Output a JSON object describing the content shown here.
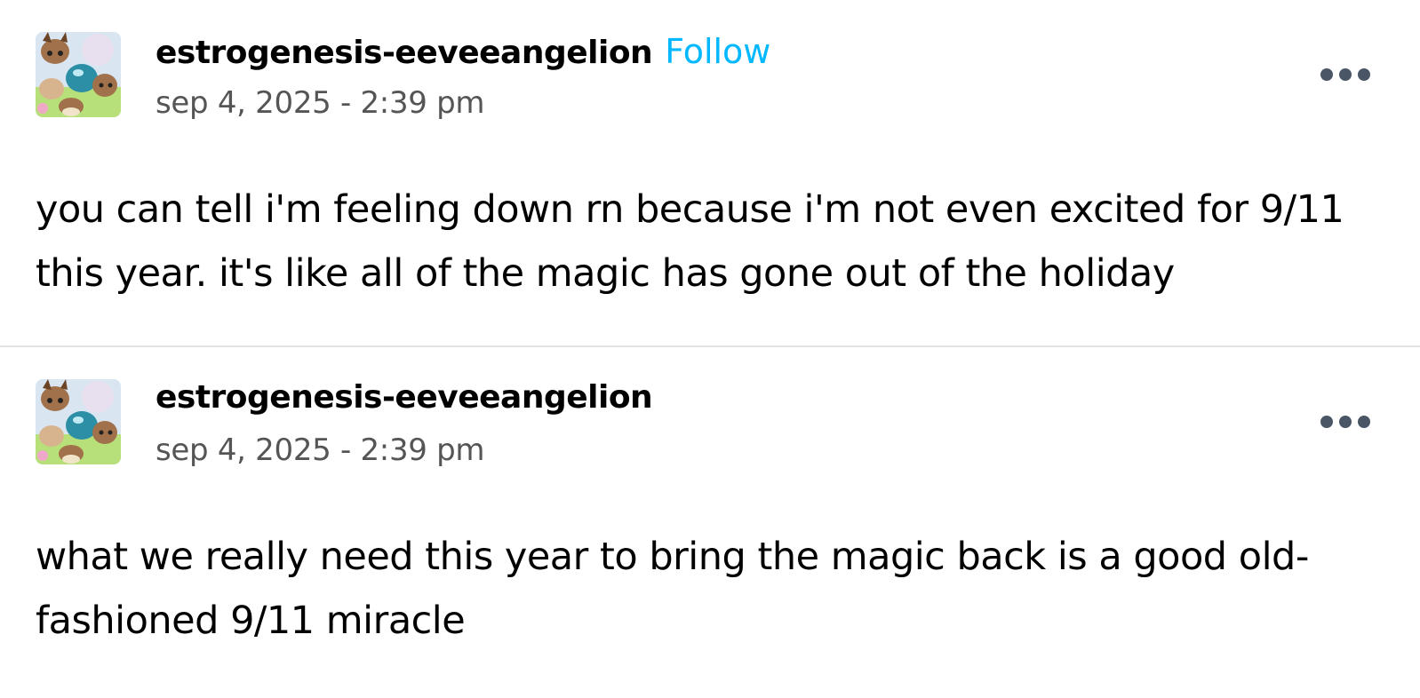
{
  "posts": [
    {
      "username": "estrogenesis-eeveeangelion",
      "follow_label": "Follow",
      "timestamp": "sep 4, 2025 - 2:39 pm",
      "body": "you can tell i'm feeling down rn because i'm not even excited for 9/11 this year. it's like all of the magic has gone out of the holiday"
    },
    {
      "username": "estrogenesis-eeveeangelion",
      "timestamp": "sep 4, 2025 - 2:39 pm",
      "body": "what we really need this year to bring the magic back is a good old-fashioned 9/11 miracle"
    }
  ],
  "colors": {
    "follow": "#00b8ff",
    "timestamp": "#555555",
    "more_dots": "#4a5666",
    "divider": "#e2e2e2"
  },
  "icons": {
    "avatar": "eevee-avatar-image",
    "more": "more-options-icon"
  }
}
